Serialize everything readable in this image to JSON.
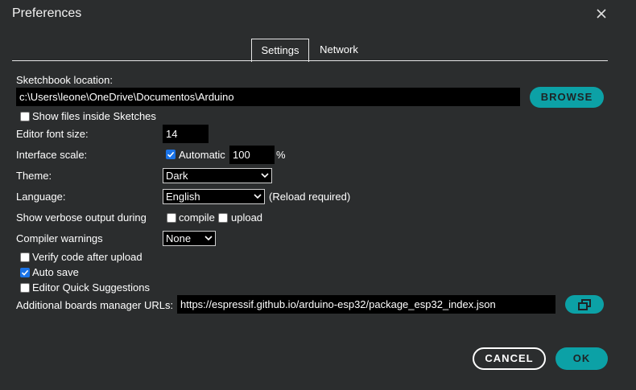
{
  "window": {
    "title": "Preferences"
  },
  "tabs": [
    {
      "label": "Settings"
    },
    {
      "label": "Network"
    }
  ],
  "settings": {
    "sketchbook_label": "Sketchbook location:",
    "sketchbook_path": "c:\\Users\\leone\\OneDrive\\Documentos\\Arduino",
    "browse_label": "BROWSE",
    "show_files_label": "Show files inside Sketches",
    "show_files_checked": false,
    "font_size_label": "Editor font size:",
    "font_size_value": "14",
    "scale_label": "Interface scale:",
    "automatic_label": "Automatic",
    "automatic_checked": true,
    "scale_value": "100",
    "scale_unit": "%",
    "theme_label": "Theme:",
    "theme_value": "Dark",
    "language_label": "Language:",
    "language_value": "English",
    "reload_note": "(Reload required)",
    "verbose_label": "Show verbose output during",
    "compile_label": "compile",
    "compile_checked": false,
    "upload_label": "upload",
    "upload_checked": false,
    "warnings_label": "Compiler warnings",
    "warnings_value": "None",
    "verify_label": "Verify code after upload",
    "verify_checked": false,
    "autosave_label": "Auto save",
    "autosave_checked": true,
    "quick_suggestions_label": "Editor Quick Suggestions",
    "quick_suggestions_checked": false,
    "boards_urls_label": "Additional boards manager URLs:",
    "boards_urls_value": "https://espressif.github.io/arduino-esp32/package_esp32_index.json"
  },
  "footer": {
    "cancel_label": "CANCEL",
    "ok_label": "OK"
  },
  "colors": {
    "background": "#2b2d2e",
    "accent": "#0ca1a6",
    "field": "#000000",
    "checkbox_checked": "#1a73e8"
  },
  "icons": {
    "close": "close-icon",
    "open_window": "open-external-window-icon",
    "dropdown": "chevron-down-icon",
    "check": "check-icon"
  }
}
